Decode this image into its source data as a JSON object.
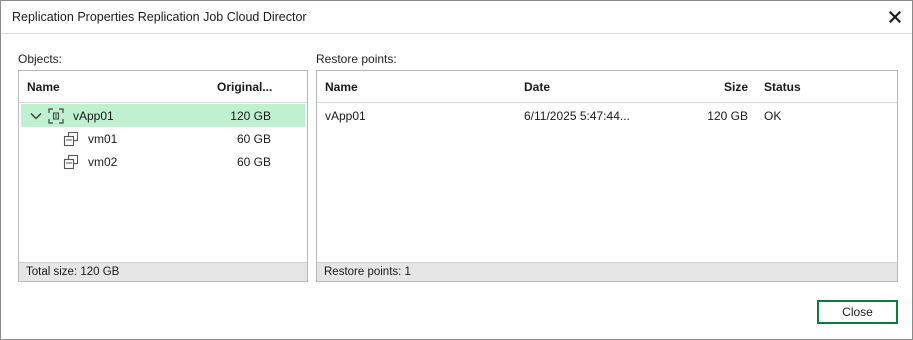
{
  "window": {
    "title": "Replication Properties Replication Job Cloud Director"
  },
  "objects": {
    "label": "Objects:",
    "columns": {
      "name": "Name",
      "original": "Original..."
    },
    "rows": [
      {
        "name": "vApp01",
        "size": "120 GB",
        "icon": "vapp-icon",
        "expanded": true,
        "selected": true
      },
      {
        "name": "vm01",
        "size": "60 GB",
        "icon": "vm-icon"
      },
      {
        "name": "vm02",
        "size": "60 GB",
        "icon": "vm-icon"
      }
    ],
    "footer": "Total size: 120 GB"
  },
  "restore_points": {
    "label": "Restore points:",
    "columns": {
      "name": "Name",
      "date": "Date",
      "size": "Size",
      "status": "Status"
    },
    "rows": [
      {
        "name": "vApp01",
        "date": "6/11/2025 5:47:44...",
        "size": "120 GB",
        "status": "OK"
      }
    ],
    "footer": "Restore points: 1"
  },
  "buttons": {
    "close": "Close"
  },
  "colors": {
    "selection": "#bff0d0",
    "accent": "#0f7b3a",
    "footer_bg": "#e6e6e6"
  }
}
